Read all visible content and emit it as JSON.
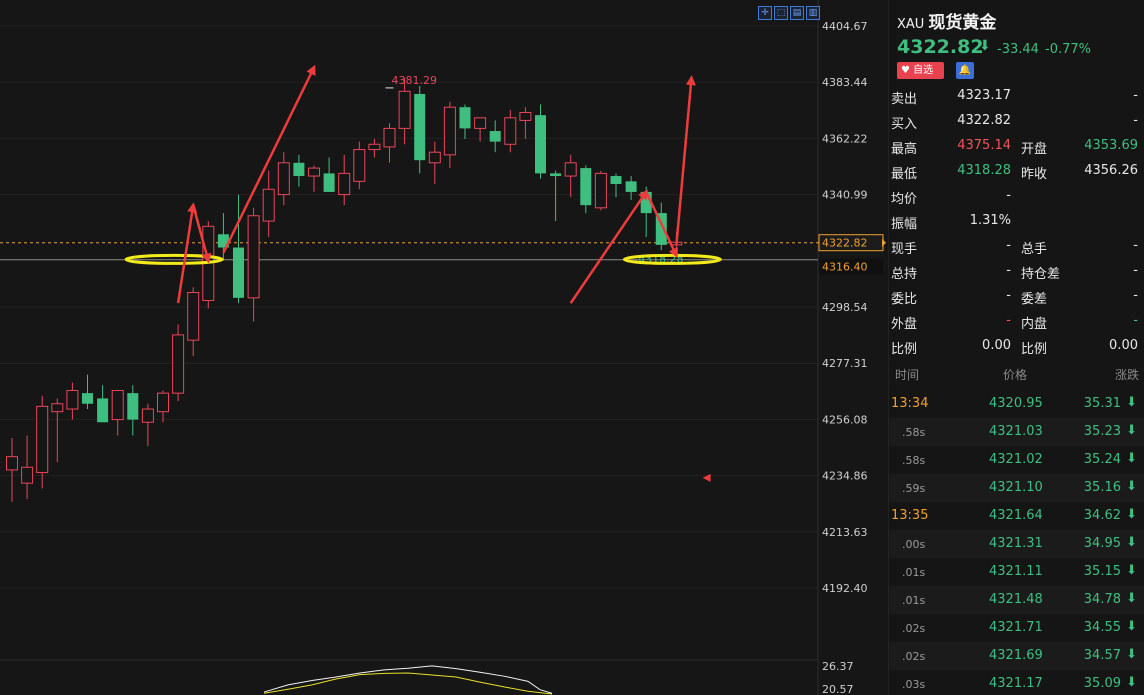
{
  "toolbar": {
    "icons": [
      "crosshair-icon",
      "cursor-icon",
      "draw-icon",
      "settings-icon"
    ],
    "glyphs": [
      "✛",
      "⬚",
      "▤",
      "▥"
    ]
  },
  "chart_data": {
    "type": "candlestick",
    "y_axis": {
      "ticks": [
        "4404.67",
        "4383.44",
        "4362.22",
        "4340.99",
        "4298.54",
        "4277.31",
        "4256.08",
        "4234.86",
        "4213.63",
        "4192.40"
      ],
      "tick_values": [
        4404.67,
        4383.44,
        4362.22,
        4340.99,
        4298.54,
        4277.31,
        4256.08,
        4234.86,
        4213.63,
        4192.4
      ],
      "range": [
        4190,
        4410
      ]
    },
    "current_price": {
      "value": 4322.82,
      "label": "4322.82"
    },
    "reference_price": {
      "value": 4316.4,
      "label": "4316.40"
    },
    "high_label": {
      "value": 4381.29,
      "text": "4381.29",
      "index": 25
    },
    "low_label": {
      "value": 4318.28,
      "text": "4318.28",
      "index": 42
    },
    "candles": [
      {
        "o": 4237,
        "h": 4249,
        "l": 4225,
        "c": 4242
      },
      {
        "o": 4232,
        "h": 4250,
        "l": 4226,
        "c": 4238
      },
      {
        "o": 4236,
        "h": 4265,
        "l": 4230,
        "c": 4261
      },
      {
        "o": 4259,
        "h": 4264,
        "l": 4240,
        "c": 4262
      },
      {
        "o": 4260,
        "h": 4270,
        "l": 4256,
        "c": 4267
      },
      {
        "o": 4266,
        "h": 4273,
        "l": 4260,
        "c": 4262
      },
      {
        "o": 4264,
        "h": 4269,
        "l": 4256,
        "c": 4255
      },
      {
        "o": 4256,
        "h": 4266,
        "l": 4250,
        "c": 4267
      },
      {
        "o": 4266,
        "h": 4269,
        "l": 4250,
        "c": 4256
      },
      {
        "o": 4255,
        "h": 4262,
        "l": 4246,
        "c": 4260
      },
      {
        "o": 4259,
        "h": 4267,
        "l": 4255,
        "c": 4266
      },
      {
        "o": 4266,
        "h": 4292,
        "l": 4263,
        "c": 4288
      },
      {
        "o": 4286,
        "h": 4306,
        "l": 4280,
        "c": 4304
      },
      {
        "o": 4301,
        "h": 4331,
        "l": 4298,
        "c": 4329
      },
      {
        "o": 4326,
        "h": 4334,
        "l": 4316,
        "c": 4321
      },
      {
        "o": 4321,
        "h": 4341,
        "l": 4300,
        "c": 4302
      },
      {
        "o": 4302,
        "h": 4336,
        "l": 4293,
        "c": 4333
      },
      {
        "o": 4331,
        "h": 4350,
        "l": 4325,
        "c": 4343
      },
      {
        "o": 4341,
        "h": 4357,
        "l": 4337,
        "c": 4353
      },
      {
        "o": 4353,
        "h": 4356,
        "l": 4344,
        "c": 4348
      },
      {
        "o": 4348,
        "h": 4352,
        "l": 4342,
        "c": 4351
      },
      {
        "o": 4349,
        "h": 4355,
        "l": 4345,
        "c": 4342
      },
      {
        "o": 4341,
        "h": 4356,
        "l": 4337,
        "c": 4349
      },
      {
        "o": 4346,
        "h": 4361,
        "l": 4343,
        "c": 4358
      },
      {
        "o": 4358,
        "h": 4362,
        "l": 4355,
        "c": 4360
      },
      {
        "o": 4359,
        "h": 4368,
        "l": 4353,
        "c": 4366
      },
      {
        "o": 4366,
        "h": 4385,
        "l": 4360,
        "c": 4380
      },
      {
        "o": 4379,
        "h": 4382,
        "l": 4349,
        "c": 4354
      },
      {
        "o": 4353,
        "h": 4361,
        "l": 4345,
        "c": 4357
      },
      {
        "o": 4356,
        "h": 4376,
        "l": 4351,
        "c": 4374
      },
      {
        "o": 4374,
        "h": 4375,
        "l": 4362,
        "c": 4366
      },
      {
        "o": 4366,
        "h": 4370,
        "l": 4361,
        "c": 4370
      },
      {
        "o": 4365,
        "h": 4369,
        "l": 4357,
        "c": 4361
      },
      {
        "o": 4360,
        "h": 4373,
        "l": 4357,
        "c": 4370
      },
      {
        "o": 4369,
        "h": 4374,
        "l": 4362,
        "c": 4372
      },
      {
        "o": 4371,
        "h": 4375,
        "l": 4347,
        "c": 4349
      },
      {
        "o": 4349,
        "h": 4350,
        "l": 4331,
        "c": 4348
      },
      {
        "o": 4348,
        "h": 4356,
        "l": 4340,
        "c": 4353
      },
      {
        "o": 4351,
        "h": 4352,
        "l": 4334,
        "c": 4337
      },
      {
        "o": 4336,
        "h": 4350,
        "l": 4335,
        "c": 4349
      },
      {
        "o": 4348,
        "h": 4349,
        "l": 4340,
        "c": 4345
      },
      {
        "o": 4346,
        "h": 4348,
        "l": 4339,
        "c": 4342
      },
      {
        "o": 4342,
        "h": 4344,
        "l": 4325,
        "c": 4334
      },
      {
        "o": 4334,
        "h": 4338,
        "l": 4320,
        "c": 4322
      },
      {
        "o": 4322,
        "h": 4327,
        "l": 4318,
        "c": 4323
      }
    ],
    "annotations": {
      "arrows": [
        {
          "from": [
            11,
            4300
          ],
          "to": [
            12,
            4337
          ]
        },
        {
          "from": [
            12,
            4337
          ],
          "to": [
            13,
            4316
          ]
        },
        {
          "from": [
            14,
            4319
          ],
          "to": [
            20,
            4389
          ]
        },
        {
          "from": [
            37,
            4300
          ],
          "to": [
            42,
            4342
          ]
        },
        {
          "from": [
            42,
            4342
          ],
          "to": [
            44,
            4318
          ]
        },
        {
          "from": [
            44,
            4322
          ],
          "to": [
            45,
            4385
          ]
        }
      ],
      "ellipses": [
        {
          "center": [
            11,
            4316.5
          ]
        },
        {
          "center": [
            44,
            4316.5
          ]
        }
      ],
      "marker": {
        "at": [
          46,
          4234
        ]
      }
    },
    "indicator": {
      "ticks": [
        "26.37",
        "20.57"
      ],
      "tick_values": [
        26.37,
        20.57
      ],
      "range": [
        19,
        27.5
      ],
      "line_white": [
        {
          "i": 0,
          "v": 19.8
        },
        {
          "i": 2,
          "v": 21.6
        },
        {
          "i": 4,
          "v": 22.7
        },
        {
          "i": 6,
          "v": 23.6
        },
        {
          "i": 8,
          "v": 24.6
        },
        {
          "i": 10,
          "v": 25.4
        },
        {
          "i": 12,
          "v": 25.8
        },
        {
          "i": 14,
          "v": 26.4
        },
        {
          "i": 16,
          "v": 25.7
        },
        {
          "i": 18,
          "v": 24.8
        },
        {
          "i": 20,
          "v": 23.8
        },
        {
          "i": 22,
          "v": 22.5
        },
        {
          "i": 23,
          "v": 20.4
        },
        {
          "i": 24,
          "v": 19.5
        }
      ],
      "line_yellow": [
        {
          "i": 0,
          "v": 19.5
        },
        {
          "i": 2,
          "v": 20.5
        },
        {
          "i": 4,
          "v": 21.6
        },
        {
          "i": 6,
          "v": 23.1
        },
        {
          "i": 8,
          "v": 24.2
        },
        {
          "i": 10,
          "v": 24.5
        },
        {
          "i": 12,
          "v": 24.6
        },
        {
          "i": 14,
          "v": 24.1
        },
        {
          "i": 16,
          "v": 23.6
        },
        {
          "i": 18,
          "v": 22.3
        },
        {
          "i": 20,
          "v": 21.1
        },
        {
          "i": 22,
          "v": 20.0
        },
        {
          "i": 24,
          "v": 19.3
        }
      ]
    }
  },
  "quote": {
    "code": "XAU",
    "name": "现货黄金",
    "price": "4322.82",
    "change": "-33.44",
    "change_pct": "-0.77%",
    "fav_label": "自选"
  },
  "stats": [
    {
      "l1": "卖出",
      "v1": "4323.17",
      "c1": "white",
      "l2": "",
      "v2": "-",
      "c2": "white"
    },
    {
      "l1": "买入",
      "v1": "4322.82",
      "c1": "white",
      "l2": "",
      "v2": "-",
      "c2": "white"
    },
    {
      "l1": "最高",
      "v1": "4375.14",
      "c1": "red",
      "l2": "开盘",
      "v2": "4353.69",
      "c2": "green"
    },
    {
      "l1": "最低",
      "v1": "4318.28",
      "c1": "green",
      "l2": "昨收",
      "v2": "4356.26",
      "c2": "white"
    },
    {
      "l1": "均价",
      "v1": "-",
      "c1": "white",
      "l2": "",
      "v2": "",
      "c2": "white"
    },
    {
      "l1": "振幅",
      "v1": "1.31%",
      "c1": "white",
      "l2": "",
      "v2": "",
      "c2": "white"
    },
    {
      "l1": "现手",
      "v1": "-",
      "c1": "white",
      "l2": "总手",
      "v2": "-",
      "c2": "white"
    },
    {
      "l1": "总持",
      "v1": "-",
      "c1": "white",
      "l2": "持仓差",
      "v2": "-",
      "c2": "white"
    },
    {
      "l1": "委比",
      "v1": "-",
      "c1": "white",
      "l2": "委差",
      "v2": "-",
      "c2": "white"
    },
    {
      "l1": "外盘",
      "v1": "-",
      "c1": "red",
      "l2": "内盘",
      "v2": "-",
      "c2": "green"
    },
    {
      "l1": "比例",
      "v1": "0.00",
      "c1": "white",
      "l2": "比例",
      "v2": "0.00",
      "c2": "white"
    }
  ],
  "ticks_header": {
    "time": "时间",
    "price": "价格",
    "change": "涨跌"
  },
  "ticks": [
    {
      "time": "13:34",
      "full": true,
      "price": "4320.95",
      "change": "35.31",
      "dir": "⬇"
    },
    {
      "time": ".58s",
      "full": false,
      "price": "4321.03",
      "change": "35.23",
      "dir": "⬇"
    },
    {
      "time": ".58s",
      "full": false,
      "price": "4321.02",
      "change": "35.24",
      "dir": "⬇"
    },
    {
      "time": ".59s",
      "full": false,
      "price": "4321.10",
      "change": "35.16",
      "dir": "⬇"
    },
    {
      "time": "13:35",
      "full": true,
      "price": "4321.64",
      "change": "34.62",
      "dir": "⬇"
    },
    {
      "time": ".00s",
      "full": false,
      "price": "4321.31",
      "change": "34.95",
      "dir": "⬇"
    },
    {
      "time": ".01s",
      "full": false,
      "price": "4321.11",
      "change": "35.15",
      "dir": "⬇"
    },
    {
      "time": ".01s",
      "full": false,
      "price": "4321.48",
      "change": "34.78",
      "dir": "⬇"
    },
    {
      "time": ".02s",
      "full": false,
      "price": "4321.71",
      "change": "34.55",
      "dir": "⬇"
    },
    {
      "time": ".02s",
      "full": false,
      "price": "4321.69",
      "change": "34.57",
      "dir": "⬇"
    },
    {
      "time": ".03s",
      "full": false,
      "price": "4321.17",
      "change": "35.09",
      "dir": "⬇"
    }
  ]
}
